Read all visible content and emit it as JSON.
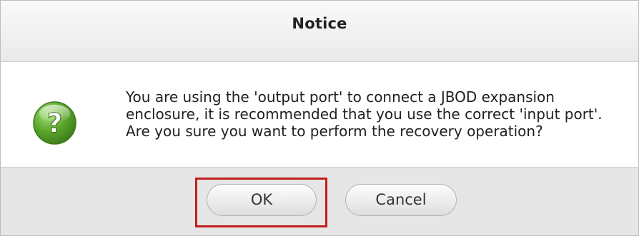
{
  "dialog": {
    "title": "Notice",
    "message": "You are using the 'output port' to connect a JBOD expansion enclosure, it is recommended that you use the correct 'input port'. Are you sure you want to perform the recovery operation?",
    "icon": "question-mark-icon",
    "icon_color": "#5aa52b",
    "buttons": {
      "ok": "OK",
      "cancel": "Cancel"
    },
    "highlight_color": "#c21d1d"
  }
}
